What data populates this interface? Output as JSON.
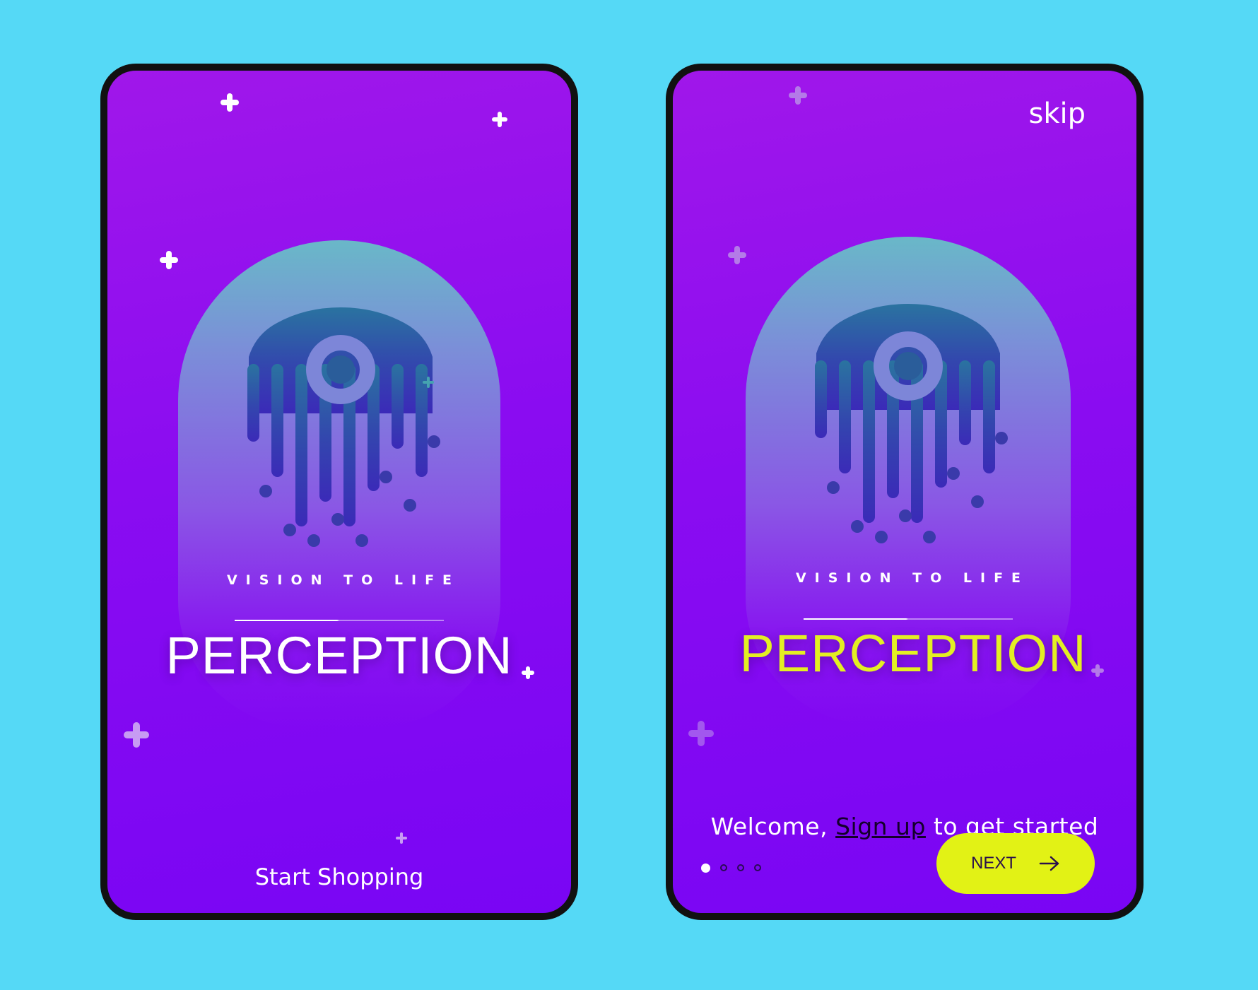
{
  "left_screen": {
    "tagline": "VISION TO LIFE",
    "brand": "PERCEPTION",
    "cta": "Start Shopping"
  },
  "right_screen": {
    "skip": "skip",
    "tagline": "VISION TO LIFE",
    "brand": "PERCEPTION",
    "welcome_prefix": "Welcome, ",
    "signup_link": "Sign up",
    "welcome_suffix": " to get started",
    "next_label": "NEXT",
    "pagination": {
      "total": 4,
      "active": 1
    }
  },
  "icons": [
    "plus-sparkle-icon",
    "jellyfish-eye-logo-icon",
    "arrow-right-icon"
  ],
  "colors": {
    "background": "#55d9f6",
    "screen_gradient_top": "#a017ea",
    "screen_gradient_bottom": "#7905f4",
    "accent_yellow": "#e2f215",
    "logo_teal": "#2a6fa4",
    "logo_indigo": "#3a3fb0"
  }
}
